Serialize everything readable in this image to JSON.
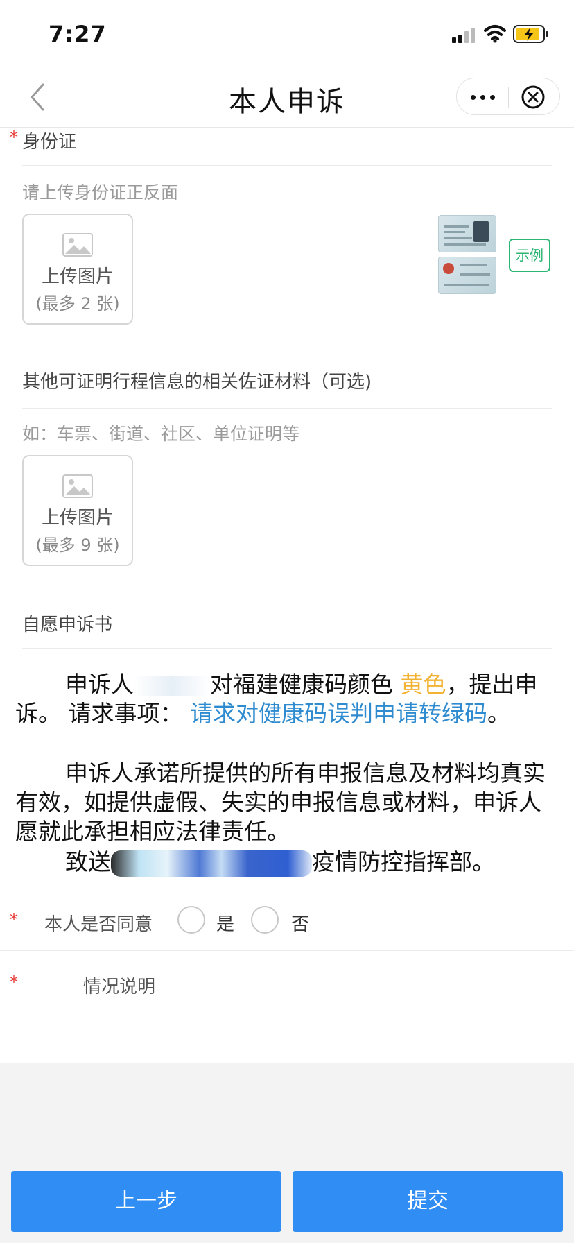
{
  "status_bar": {
    "time": "7:27"
  },
  "nav": {
    "title": "本人申诉"
  },
  "id_card": {
    "required": "*",
    "label": "身份证",
    "hint": "请上传身份证正反面",
    "upload_label": "上传图片",
    "upload_limit": "(最多 2 张)",
    "example_label": "示例"
  },
  "other_materials": {
    "label": "其他可证明行程信息的相关佐证材料（可选)",
    "hint": "如：车票、街道、社区、单位证明等",
    "upload_label": "上传图片",
    "upload_limit": "(最多 9 张)"
  },
  "statement": {
    "title": "自愿申诉书",
    "p1_a": "申诉人",
    "p1_b": "对福建健康码颜色",
    "p1_color": "黄色",
    "p1_c": "，提出申诉。 请求事项：",
    "p1_request": "请求对健康码误判申请转绿码",
    "p1_end": "。",
    "p2": "申诉人承诺所提供的所有申报信息及材料均真实有效，如提供虚假、失实的申报信息或材料，申诉人愿就此承担相应法律责任。",
    "p3_a": "致送",
    "p3_b": "疫情防控指挥部。"
  },
  "consent": {
    "required": "*",
    "label": "本人是否同意",
    "yes": "是",
    "no": "否"
  },
  "description": {
    "required": "*",
    "label": "情况说明"
  },
  "footer": {
    "prev_label": "上一步",
    "submit_label": "提交"
  },
  "colors": {
    "primary": "#2f8df3",
    "required": "#e53935",
    "highlight_yellow": "#f2b233",
    "highlight_blue": "#2e8bcf",
    "example_green": "#2bb673"
  }
}
